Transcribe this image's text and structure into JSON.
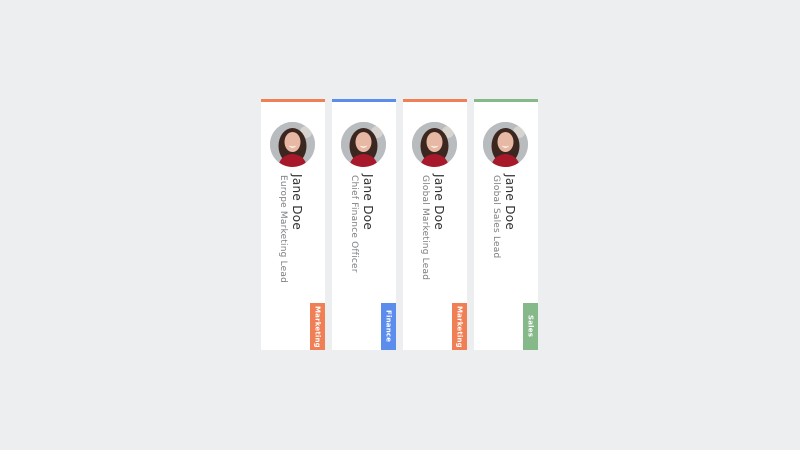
{
  "colors": {
    "marketing": "#f07f56",
    "finance": "#5b8ded",
    "sales": "#86b98a"
  },
  "cards": [
    {
      "name": "Jane Doe",
      "title": "Europe Marketing Lead",
      "tag": "Marketing",
      "color": "#f07f56"
    },
    {
      "name": "Jane Doe",
      "title": "Chief Finance Officer",
      "tag": "Finance",
      "color": "#5b8ded"
    },
    {
      "name": "Jane Doe",
      "title": "Global Marketing Lead",
      "tag": "Marketing",
      "color": "#f07f56"
    },
    {
      "name": "Jane Doe",
      "title": "Global Sales Lead",
      "tag": "Sales",
      "color": "#86b98a"
    }
  ]
}
